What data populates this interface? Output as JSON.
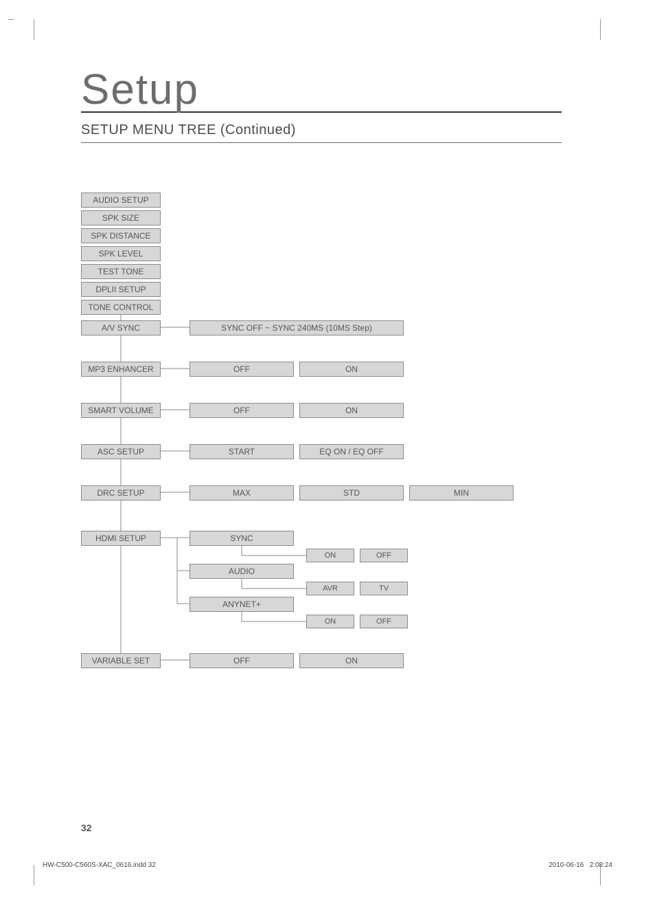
{
  "headline": "Setup",
  "subhead": "SETUP MENU TREE (Continued)",
  "col1": {
    "audio_setup": "AUDIO SETUP",
    "spk_size": "SPK SIZE",
    "spk_distance": "SPK DISTANCE",
    "spk_level": "SPK LEVEL",
    "test_tone": "TEST TONE",
    "dplii_setup": "DPLII SETUP",
    "tone_control": "TONE CONTROL",
    "av_sync": "A/V SYNC",
    "mp3": "MP3 ENHANCER",
    "smart_vol": "SMART VOLUME",
    "asc": "ASC SETUP",
    "drc": "DRC SETUP",
    "hdmi": "HDMI SETUP",
    "variable": "VARIABLE SET"
  },
  "opts": {
    "sync_off": "SYNC OFF ~ SYNC 240MS (10MS Step)",
    "off": "OFF",
    "on": "ON",
    "start": "START",
    "eq": "EQ ON / EQ OFF",
    "max": "MAX",
    "std": "STD",
    "min": "MIN",
    "sync": "SYNC",
    "audio": "AUDIO",
    "anynet": "ANYNET+",
    "avr": "AVR",
    "tv": "TV"
  },
  "pagenum": "32",
  "footer_left": "HW-C500-C560S-XAC_0616.indd   32",
  "footer_date": "2010-06-16",
  "footer_time": "2:08:24",
  "chart_data": {
    "type": "tree",
    "title": "SETUP MENU TREE (Continued)",
    "nodes": [
      {
        "label": "AUDIO SETUP"
      },
      {
        "label": "SPK SIZE"
      },
      {
        "label": "SPK DISTANCE"
      },
      {
        "label": "SPK LEVEL"
      },
      {
        "label": "TEST TONE"
      },
      {
        "label": "DPLII SETUP"
      },
      {
        "label": "TONE CONTROL"
      },
      {
        "label": "A/V SYNC",
        "children": [
          {
            "label": "SYNC OFF ~ SYNC 240MS (10MS Step)"
          }
        ]
      },
      {
        "label": "MP3 ENHANCER",
        "children": [
          {
            "label": "OFF"
          },
          {
            "label": "ON"
          }
        ]
      },
      {
        "label": "SMART VOLUME",
        "children": [
          {
            "label": "OFF"
          },
          {
            "label": "ON"
          }
        ]
      },
      {
        "label": "ASC SETUP",
        "children": [
          {
            "label": "START"
          },
          {
            "label": "EQ ON / EQ OFF"
          }
        ]
      },
      {
        "label": "DRC SETUP",
        "children": [
          {
            "label": "MAX"
          },
          {
            "label": "STD"
          },
          {
            "label": "MIN"
          }
        ]
      },
      {
        "label": "HDMI SETUP",
        "children": [
          {
            "label": "SYNC",
            "children": [
              {
                "label": "ON"
              },
              {
                "label": "OFF"
              }
            ]
          },
          {
            "label": "AUDIO",
            "children": [
              {
                "label": "AVR"
              },
              {
                "label": "TV"
              }
            ]
          },
          {
            "label": "ANYNET+",
            "children": [
              {
                "label": "ON"
              },
              {
                "label": "OFF"
              }
            ]
          }
        ]
      },
      {
        "label": "VARIABLE SET",
        "children": [
          {
            "label": "OFF"
          },
          {
            "label": "ON"
          }
        ]
      }
    ]
  }
}
